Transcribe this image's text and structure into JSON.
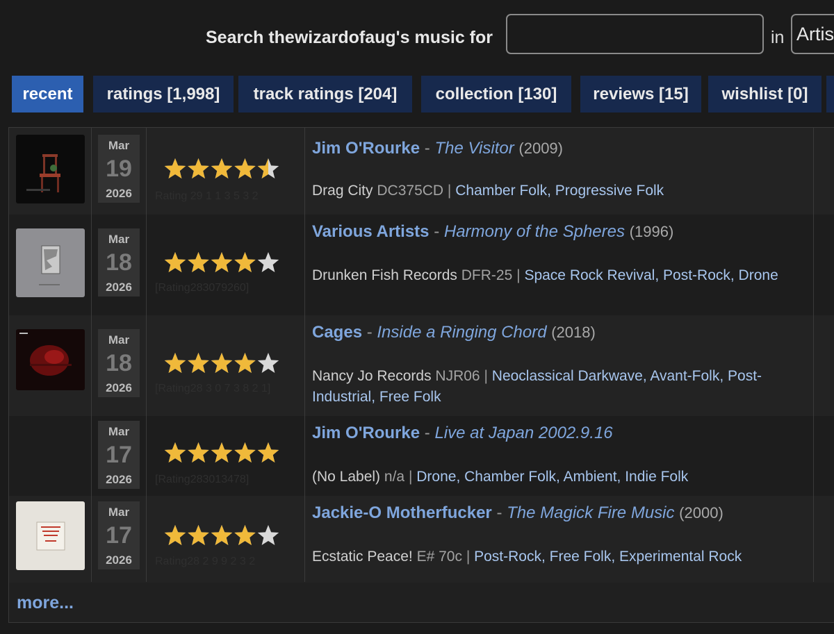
{
  "search": {
    "label": "Search thewizardofaug's music for",
    "value": "",
    "in_label": "in",
    "scope_selected": "Artis"
  },
  "tabs": [
    {
      "label": "recent",
      "active": true
    },
    {
      "label": "ratings [1,998]",
      "active": false
    },
    {
      "label": "track ratings [204]",
      "active": false
    },
    {
      "label": "collection [130]",
      "active": false
    },
    {
      "label": "reviews [15]",
      "active": false
    },
    {
      "label": "wishlist [0]",
      "active": false
    }
  ],
  "entries": [
    {
      "month": "Mar",
      "day": "19",
      "year": "2026",
      "rating": 4.5,
      "artist": "Jim O'Rourke",
      "album": "The Visitor",
      "release_year": "(2009)",
      "label": "Drag City",
      "catno": "DC375CD",
      "genres": "Chamber Folk, Progressive Folk",
      "cover": "dark-chair-art"
    },
    {
      "month": "Mar",
      "day": "18",
      "year": "2026",
      "rating": 4,
      "artist": "Various Artists",
      "album": "Harmony of the Spheres",
      "release_year": "(1996)",
      "label": "Drunken Fish Records",
      "catno": "DFR-25",
      "genres": "Space Rock Revival, Post-Rock, Drone",
      "cover": "grey-engraving-art"
    },
    {
      "month": "Mar",
      "day": "18",
      "year": "2026",
      "rating": 4,
      "artist": "Cages",
      "album": "Inside a Ringing Chord",
      "release_year": "(2018)",
      "label": "Nancy Jo Records",
      "catno": "NJR06",
      "genres": "Neoclassical Darkwave, Avant-Folk, Post-Industrial, Free Folk",
      "cover": "red-dark-art"
    },
    {
      "month": "Mar",
      "day": "17",
      "year": "2026",
      "rating": 5,
      "artist": "Jim O'Rourke",
      "album": "Live at Japan 2002.9.16",
      "release_year": "",
      "label": "(No Label)",
      "catno": "n/a",
      "genres": "Drone, Chamber Folk, Ambient, Indie Folk",
      "cover": ""
    },
    {
      "month": "Mar",
      "day": "17",
      "year": "2026",
      "rating": 4,
      "artist": "Jackie-O Motherfucker",
      "album": "The Magick Fire Music",
      "release_year": "(2000)",
      "label": "Ecstatic Peace!",
      "catno": "E# 70c",
      "genres": "Post-Rock, Free Folk, Experimental Rock",
      "cover": "white-note-art"
    }
  ],
  "more_label": "more...",
  "colors": {
    "accent_tab": "#2c5fb0",
    "tab_bg": "#17294d",
    "link": "#7fa6dd",
    "star": "#f0b93a"
  }
}
